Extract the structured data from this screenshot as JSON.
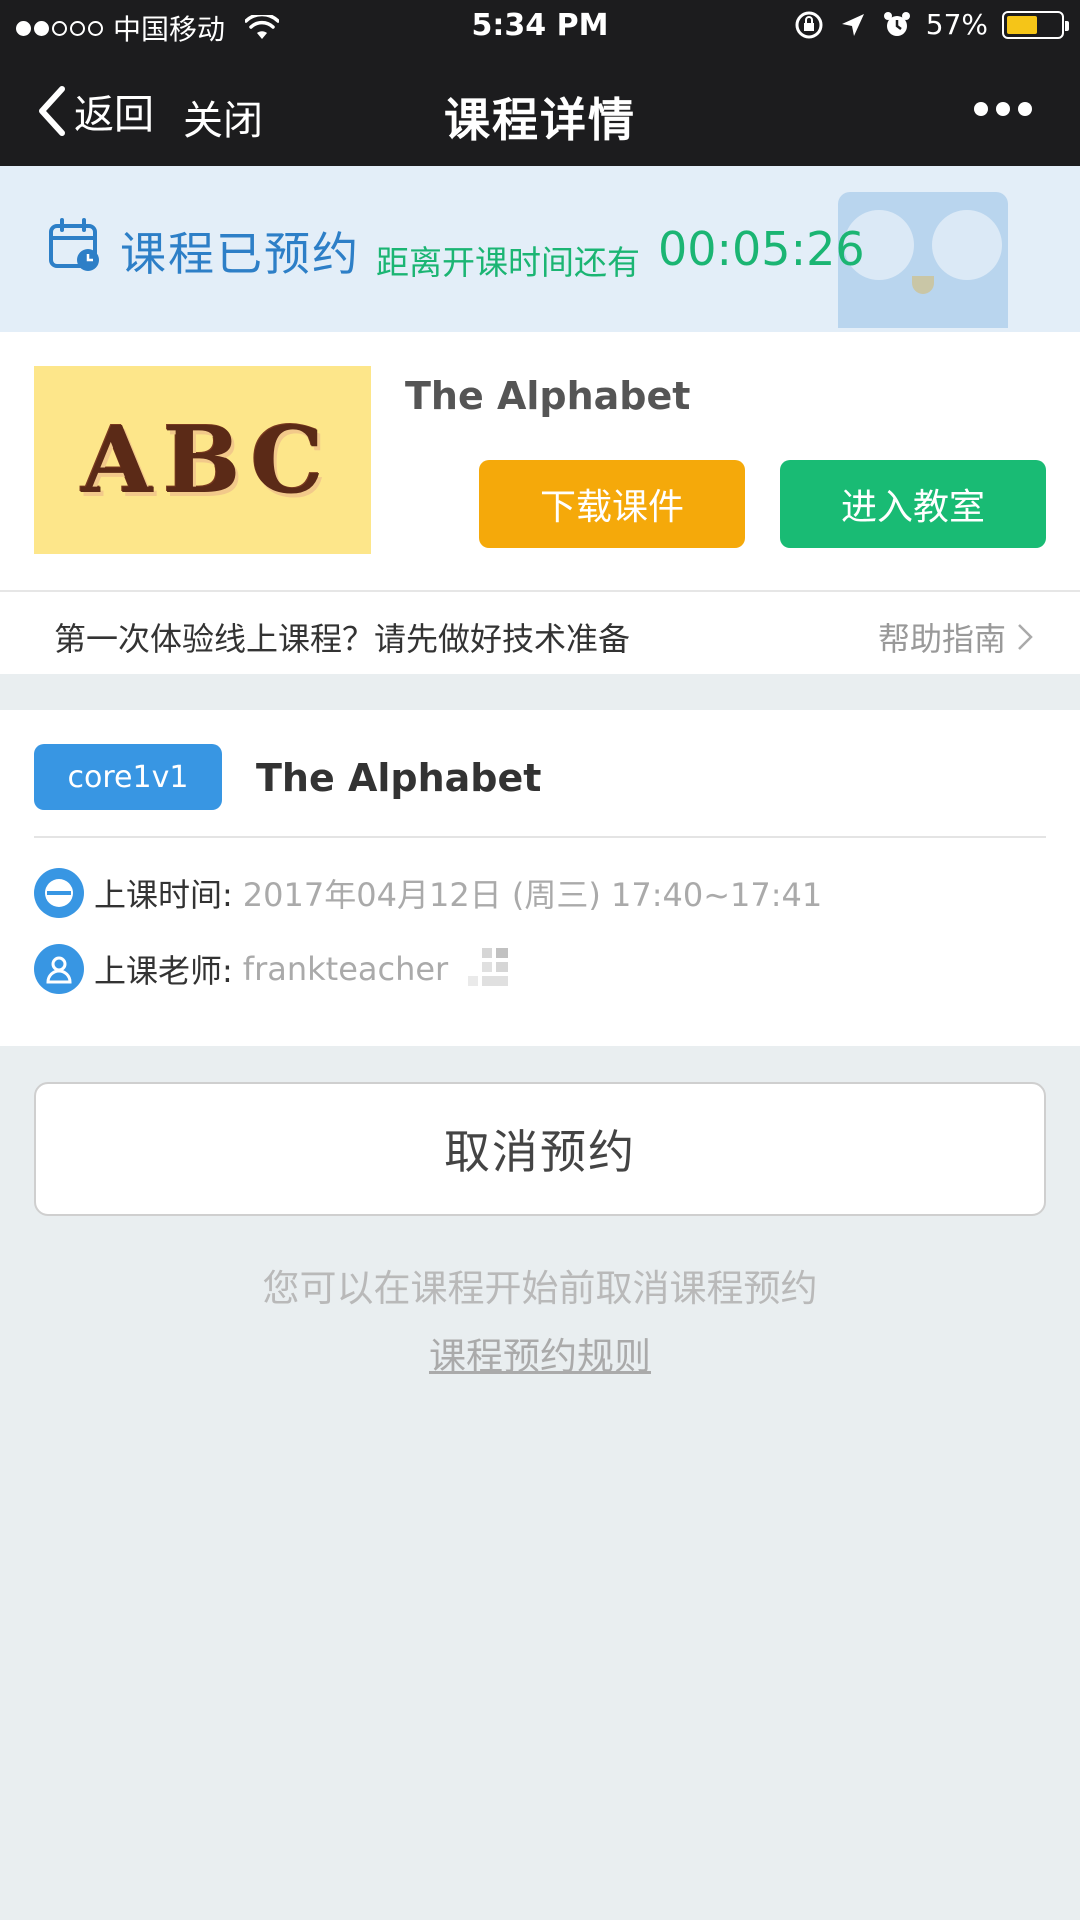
{
  "status_bar": {
    "carrier": "中国移动",
    "time": "5:34 PM",
    "battery_percent": "57%",
    "battery_level": 0.57,
    "signal_dots_filled": 2,
    "signal_dots_total": 5
  },
  "nav": {
    "back_label": "返回",
    "close_label": "关闭",
    "title": "课程详情"
  },
  "banner": {
    "status_text": "课程已预约",
    "countdown_label": "距离开课时间还有",
    "countdown": "00:05:26"
  },
  "course_card": {
    "thumbnail_letters": [
      "A",
      "B",
      "C"
    ],
    "name": "The Alphabet",
    "download_button": "下载课件",
    "enter_button": "进入教室"
  },
  "tech_prep": {
    "text": "第一次体验线上课程？请先做好技术准备",
    "link": "帮助指南"
  },
  "details": {
    "type_badge": "core1v1",
    "title": "The Alphabet",
    "time_label": "上课时间:",
    "time_value": "2017年04月12日 (周三) 17:40~17:41",
    "teacher_label": "上课老师:",
    "teacher_value": "frankteacher"
  },
  "cancel": {
    "button": "取消预约",
    "note": "您可以在课程开始前取消课程预约",
    "rules_link": "课程预约规则"
  },
  "colors": {
    "accent_blue": "#3896e3",
    "green": "#19bb74",
    "orange": "#f5a90a",
    "nav_bg": "#1c1c1e",
    "banner_bg": "#e3eef8",
    "page_bg": "#e9eef0"
  }
}
